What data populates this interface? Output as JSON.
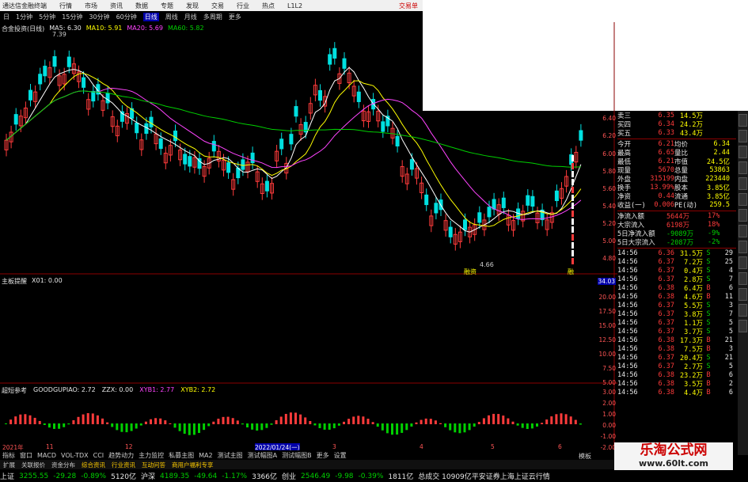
{
  "app": {
    "title": "通达信金融终端",
    "menus": [
      "行情",
      "市场",
      "资讯",
      "数据",
      "专题",
      "发现",
      "交易",
      "行业",
      "热点",
      "L1L2"
    ],
    "trade_label": "交易单"
  },
  "periods": [
    "日",
    "1分钟",
    "5分钟",
    "15分钟",
    "30分钟",
    "60分钟",
    "日线",
    "周线",
    "月线",
    "多周期",
    "更多"
  ],
  "active_period": "日线",
  "ma_legend": {
    "name": "合金投资(日线)",
    "ma5": "MA5: 6.30",
    "ma10": "MA10: 5.91",
    "ma20": "MA20: 5.69",
    "ma60": "MA60: 5.82"
  },
  "price_annotations": {
    "high": "7.39",
    "low": "4.66",
    "marker": "融资",
    "marker2": "融"
  },
  "right_axis_price": [
    "6.40",
    "6.20",
    "6.00",
    "5.80",
    "5.60",
    "5.40",
    "5.20",
    "5.00",
    "4.80"
  ],
  "right_axis_sub1": [
    "34.03",
    "20.00",
    "17.50",
    "15.00",
    "12.50",
    "10.00",
    "7.50",
    "5.00"
  ],
  "right_axis_sub2": [
    "3.00",
    "2.00",
    "1.00",
    "0.00",
    "-1.00",
    "-2.00"
  ],
  "sub1": {
    "name": "主板提醒",
    "value": "X01: 0.00"
  },
  "sub2": {
    "name": "超短参考",
    "v1": "GOODGUPIAO: 2.72",
    "v2": "ZZX: 0.00",
    "v3": "XYB1: 2.77",
    "v4": "XYB2: 2.72"
  },
  "date_ticks": [
    "2021年",
    "11",
    "12",
    "2022/01/24(一)",
    "3",
    "4",
    "5",
    "6"
  ],
  "quote": {
    "levels": [
      {
        "label": "卖三",
        "price": "6.35",
        "vol": "14.5万"
      },
      {
        "label": "买四",
        "price": "6.34",
        "vol": "24.2万"
      },
      {
        "label": "买五",
        "price": "6.33",
        "vol": "43.4万"
      }
    ],
    "stats": [
      {
        "l1": "今开",
        "v1": "6.21",
        "l2": "均价",
        "v2": "6.34"
      },
      {
        "l1": "最高",
        "v1": "6.65",
        "l2": "量比",
        "v2": "2.44"
      },
      {
        "l1": "最低",
        "v1": "6.21",
        "l2": "市值",
        "v2": "24.5亿"
      },
      {
        "l1": "现量",
        "v1": "5670",
        "l2": "总量",
        "v2": "53863"
      },
      {
        "l1": "外盘",
        "v1": "315199",
        "l2": "内盘",
        "v2": "223440"
      },
      {
        "l1": "换手",
        "v1": "13.99%",
        "l2": "股本",
        "v2": "3.85亿"
      },
      {
        "l1": "净资",
        "v1": "0.44",
        "l2": "流通",
        "v2": "3.85亿"
      },
      {
        "l1": "收益(一)",
        "v1": "0.006",
        "l2": "PE(动)",
        "v2": "259.5"
      }
    ],
    "flows": [
      {
        "label": "净流入额",
        "value": "5644万",
        "pct": "17%"
      },
      {
        "label": "大宗流入",
        "value": "6198万",
        "pct": "18%"
      },
      {
        "label": "5日净流入额",
        "value": "-9089万",
        "pct": "-9%"
      },
      {
        "label": "5日大宗流入",
        "value": "-2087万",
        "pct": "-2%"
      }
    ],
    "ticks": [
      {
        "t": "14:56",
        "p": "6.36",
        "v": "31.5万",
        "s": "S",
        "n": "29"
      },
      {
        "t": "14:56",
        "p": "6.37",
        "v": "7.2万",
        "s": "S",
        "n": "25"
      },
      {
        "t": "14:56",
        "p": "6.37",
        "v": "0.4万",
        "s": "S",
        "n": "4"
      },
      {
        "t": "14:56",
        "p": "6.37",
        "v": "2.8万",
        "s": "S",
        "n": "7"
      },
      {
        "t": "14:56",
        "p": "6.38",
        "v": "6.4万",
        "s": "B",
        "n": "6"
      },
      {
        "t": "14:56",
        "p": "6.38",
        "v": "4.6万",
        "s": "B",
        "n": "11"
      },
      {
        "t": "14:56",
        "p": "6.37",
        "v": "5.5万",
        "s": "S",
        "n": "3"
      },
      {
        "t": "14:56",
        "p": "6.37",
        "v": "3.8万",
        "s": "S",
        "n": "7"
      },
      {
        "t": "14:56",
        "p": "6.37",
        "v": "1.1万",
        "s": "S",
        "n": "5"
      },
      {
        "t": "14:56",
        "p": "6.37",
        "v": "3.7万",
        "s": "S",
        "n": "5"
      },
      {
        "t": "14:56",
        "p": "6.38",
        "v": "17.3万",
        "s": "B",
        "n": "21"
      },
      {
        "t": "14:56",
        "p": "6.38",
        "v": "7.5万",
        "s": "B",
        "n": "3"
      },
      {
        "t": "14:56",
        "p": "6.37",
        "v": "20.4万",
        "s": "S",
        "n": "21"
      },
      {
        "t": "14:56",
        "p": "6.37",
        "v": "2.7万",
        "s": "S",
        "n": "5"
      },
      {
        "t": "14:56",
        "p": "6.38",
        "v": "23.2万",
        "s": "B",
        "n": "6"
      },
      {
        "t": "14:56",
        "p": "6.38",
        "v": "3.5万",
        "s": "B",
        "n": "2"
      },
      {
        "t": "14:56",
        "p": "6.38",
        "v": "4.4万",
        "s": "B",
        "n": "6"
      }
    ]
  },
  "bottom_tabs": [
    "指标",
    "窗口",
    "MACD",
    "VOL-TDX",
    "CCI",
    "趋势动力",
    "主力监控",
    "私募主图",
    "MA2",
    "测试主图",
    "测试幅图A",
    "测试幅图B",
    "更多",
    "设置"
  ],
  "bottom_tabs2": [
    "扩展",
    "关联报价",
    "资金分布",
    "综合资讯",
    "行业资讯",
    "互动问答",
    "商用户福利专享"
  ],
  "bottom_right": "模板",
  "status": [
    {
      "label": "上证",
      "v": "3255.55",
      "c": "-29.28",
      "p": "-0.89%",
      "a": "5120亿"
    },
    {
      "label": "沪深",
      "v": "4189.35",
      "c": "-49.64",
      "p": "-1.17%",
      "a": "3366亿"
    },
    {
      "label": "创业",
      "v": "2546.49",
      "c": "-9.98",
      "p": "-0.39%",
      "a": "1811亿"
    }
  ],
  "status_tail": "总成交 10909亿平安证券上海上证云行情",
  "watermark": {
    "line1": "乐淘公式网",
    "line2": "www.60lt.com"
  },
  "colors": {
    "up": "#ff3b3b",
    "down": "#00e0e0",
    "ma5": "#ffffff",
    "ma10": "#ffff00",
    "ma20": "#ff44ff",
    "ma60": "#00d000"
  }
}
